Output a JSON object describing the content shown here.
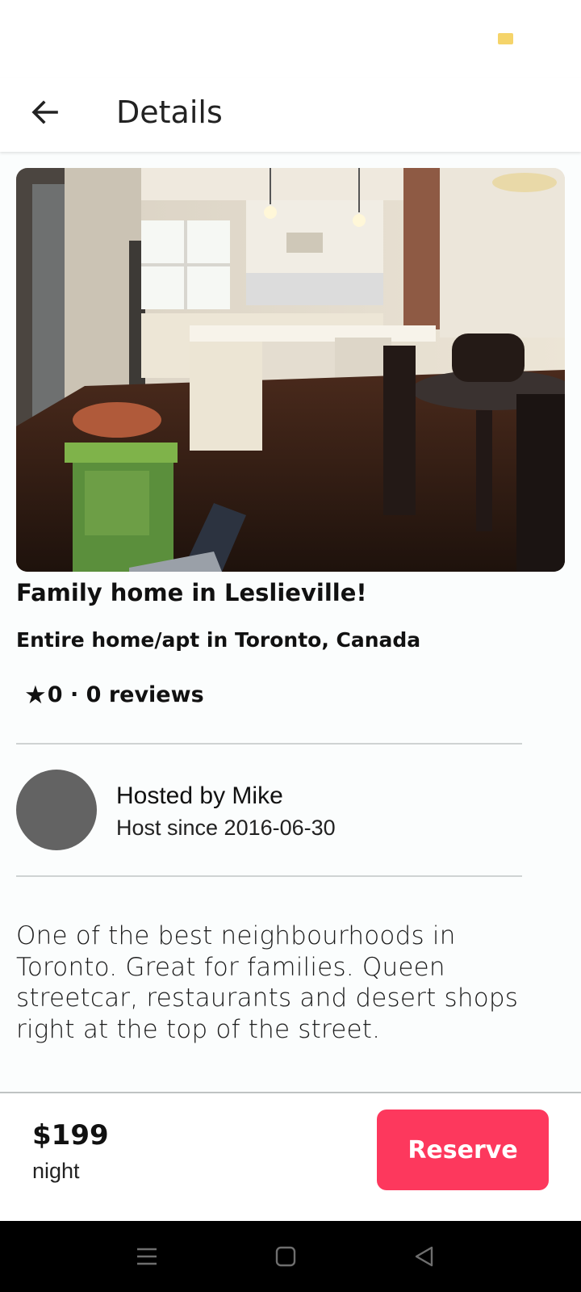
{
  "status_bar": {
    "indicator_color": "#f5d46a"
  },
  "header": {
    "title": "Details",
    "back_icon": "arrow-left-icon"
  },
  "listing": {
    "title": "Family home in Leslieville!",
    "subtitle": "Entire home/apt in Toronto, Canada",
    "rating": {
      "star_icon": "star-icon",
      "text": "0 · 0 reviews"
    },
    "photo": {
      "subject": "kitchen-and-dining-room"
    }
  },
  "host": {
    "name": "Hosted by Mike",
    "since": "Host since 2016-06-30",
    "avatar_color": "#636363"
  },
  "description": "One of the best neighbourhoods in Toronto. Great for families. Queen streetcar, restaurants and desert shops right at the top of the street.",
  "booking": {
    "price": "$199",
    "unit": "night",
    "reserve_label": "Reserve"
  },
  "colors": {
    "accent": "#fd385d",
    "divider": "#cfd3d3",
    "nav_bar": "#000000"
  },
  "system_nav": {
    "icons": [
      "menu-icon",
      "home-square-icon",
      "back-triangle-icon"
    ]
  }
}
